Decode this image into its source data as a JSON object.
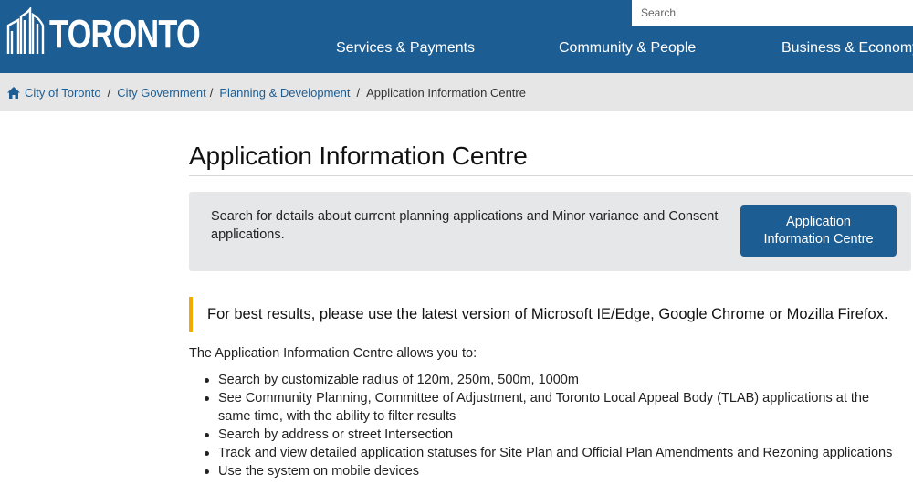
{
  "header": {
    "logo_text": "TORONTO",
    "search_placeholder": "Search",
    "nav": [
      "Services & Payments",
      "Community & People",
      "Business & Economy"
    ]
  },
  "breadcrumb": {
    "items": [
      "City of Toronto",
      "City Government",
      "Planning & Development"
    ],
    "current": "Application Information Centre"
  },
  "page": {
    "title": "Application Information Centre",
    "callout": {
      "text": "Search for details about current planning applications and Minor variance and Consent applications.",
      "button_line1": "Application",
      "button_line2": "Information Centre"
    },
    "notice": "For best results, please use the latest version of Microsoft IE/Edge, Google Chrome or Mozilla Firefox.",
    "intro": "The Application Information Centre allows you to:",
    "features": [
      "Search by customizable radius of 120m, 250m, 500m, 1000m",
      "See Community Planning, Committee of Adjustment, and Toronto Local Appeal Body (TLAB) applications at the same time, with the ability to filter results",
      "Search by address or street Intersection",
      "Track and view detailed application statuses for Site Plan and Official Plan Amendments and Rezoning applications",
      "Use the system on mobile devices"
    ]
  },
  "colors": {
    "brand_blue": "#1c5d93",
    "breadcrumb_bg": "#e6e6e6",
    "callout_bg": "#e6e7e8",
    "notice_accent": "#f2a900"
  }
}
